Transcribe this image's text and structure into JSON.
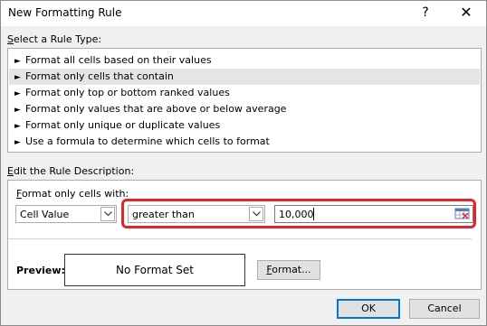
{
  "window": {
    "title": "New Formatting Rule",
    "help_glyph": "?",
    "close_glyph": "✕"
  },
  "rule_type": {
    "label_prefix": "",
    "label_mnemonic": "S",
    "label_rest": "elect a Rule Type:",
    "items": [
      {
        "label": "Format all cells based on their values",
        "selected": false
      },
      {
        "label": "Format only cells that contain",
        "selected": true
      },
      {
        "label": "Format only top or bottom ranked values",
        "selected": false
      },
      {
        "label": "Format only values that are above or below average",
        "selected": false
      },
      {
        "label": "Format only unique or duplicate values",
        "selected": false
      },
      {
        "label": "Use a formula to determine which cells to format",
        "selected": false
      }
    ],
    "arrow_glyph": "►"
  },
  "description": {
    "label_mnemonic": "E",
    "label_rest": "dit the Rule Description:",
    "format_only_mnemonic": "F",
    "format_only_rest": "ormat only cells with:",
    "cell_value_select": "Cell Value",
    "operator_select": "greater than",
    "value_input": "10,000",
    "preview_label": "Preview:",
    "preview_text": "No Format Set",
    "format_button_mnemonic": "F",
    "format_button_rest": "ormat..."
  },
  "footer": {
    "ok_label": "OK",
    "cancel_label": "Cancel"
  },
  "colors": {
    "highlight": "#e3242b",
    "selection": "#e5e5e5",
    "default_button_border": "#0078d7"
  }
}
